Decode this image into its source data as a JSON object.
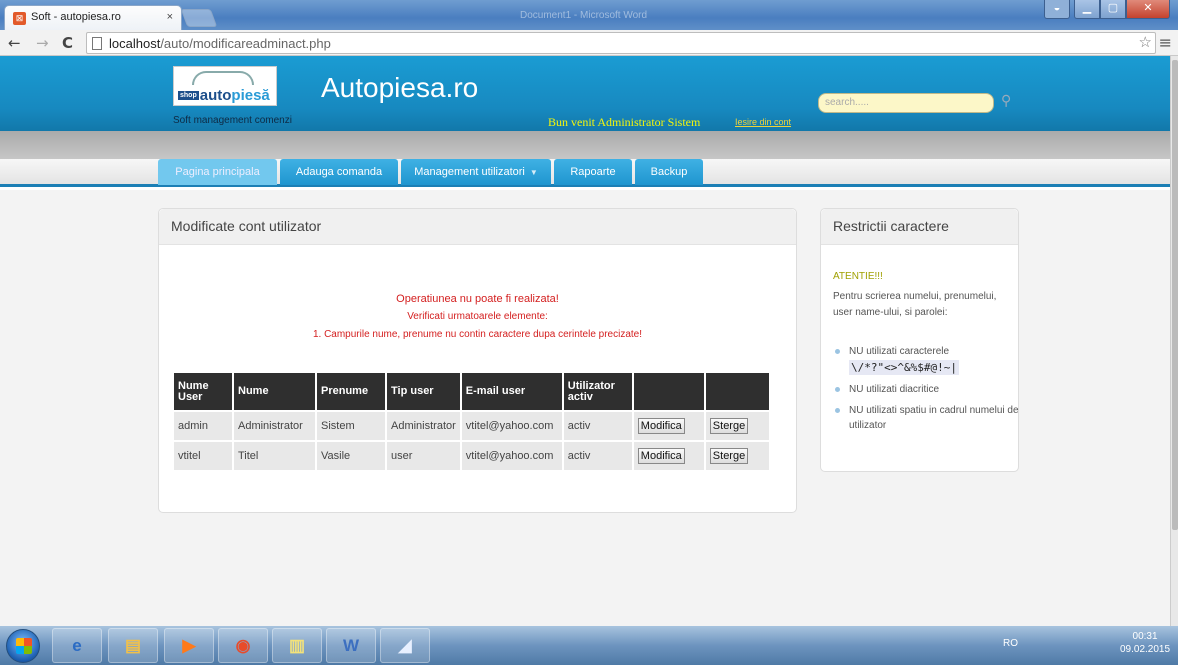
{
  "browser": {
    "tab_title": "Soft - autopiesa.ro",
    "tab_close": "×",
    "background_window_title": "Document1 - Microsoft Word",
    "url_host": "localhost",
    "url_path": "/auto/modificareadminact.php",
    "back_icon": "←",
    "forward_icon": "→",
    "reload_icon": "C",
    "star_icon": "☆",
    "menu_icon": "≡"
  },
  "header": {
    "logo_badge": "shop",
    "logo_text_1": "auto",
    "logo_text_2": "piesă",
    "tagline": "Soft management comenzi",
    "site_title": "Autopiesa.ro",
    "welcome": "Bun venit Administrator Sistem",
    "logout": "Iesire din cont",
    "search_placeholder": "search....."
  },
  "nav": {
    "tabs": [
      {
        "label": "Pagina principala"
      },
      {
        "label": "Adauga comanda"
      },
      {
        "label": "Management utilizatori"
      },
      {
        "label": "Rapoarte"
      },
      {
        "label": "Backup"
      }
    ]
  },
  "main": {
    "panel_title": "Modificate cont utilizator",
    "error_title": "Operatiunea nu poate fi realizata!",
    "error_subtitle": "Verificati urmatoarele elemente:",
    "error_item": "1. Campurile nume, prenume nu contin caractere dupa cerintele precizate!",
    "columns": [
      "Nume User",
      "Nume",
      "Prenume",
      "Tip user",
      "E-mail user",
      "Utilizator activ",
      "",
      ""
    ],
    "rows": [
      {
        "username": "admin",
        "nume": "Administrator",
        "prenume": "Sistem",
        "tip": "Administrator",
        "email": "vtitel@yahoo.com",
        "activ": "activ",
        "edit": "Modifica",
        "delete": "Sterge"
      },
      {
        "username": "vtitel",
        "nume": "Titel",
        "prenume": "Vasile",
        "tip": "user",
        "email": "vtitel@yahoo.com",
        "activ": "activ",
        "edit": "Modifica",
        "delete": "Sterge"
      }
    ]
  },
  "sidebar": {
    "title": "Restrictii caractere",
    "warning": "ATENTIE!!!",
    "info": "Pentru scrierea numelui, prenumelui, user name-ului, si parolei:",
    "rules": [
      "NU utilizati caracterele",
      "NU utilizati diacritice",
      "NU utilizati spatiu in cadrul numelui de utilizator"
    ],
    "forbidden_chars": "\\/*?\"<>^&%$#@!~|"
  },
  "taskbar": {
    "lang": "RO",
    "time": "00:31",
    "date": "09.02.2015"
  },
  "colors": {
    "header_blue": "#1a9cd3",
    "menu_blue": "#1f95cf",
    "error_red": "#d42020",
    "welcome_yellow": "#f6f60a",
    "table_header": "#2f2f2f"
  }
}
